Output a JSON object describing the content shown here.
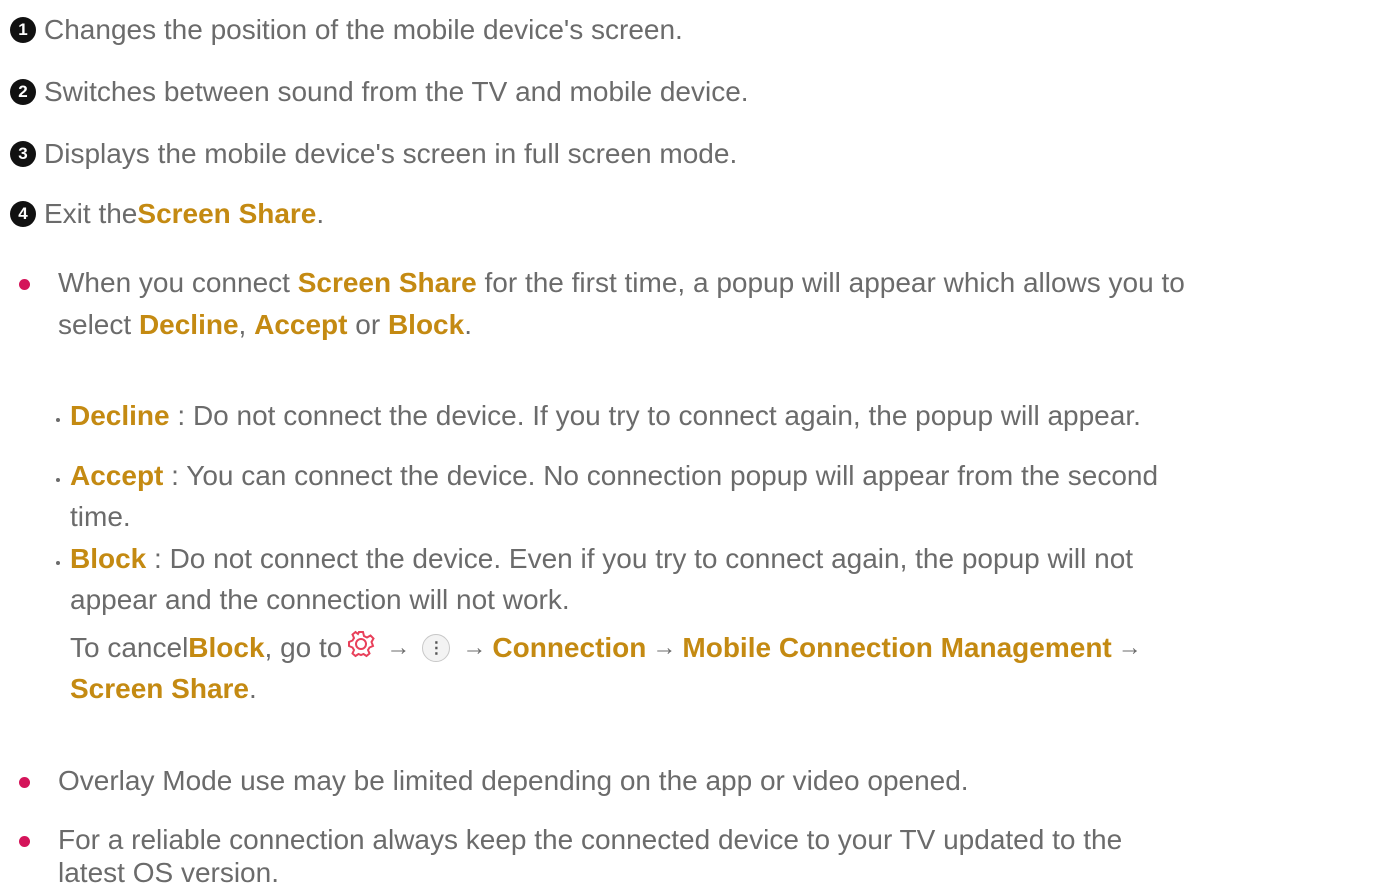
{
  "numbered": [
    {
      "number": "1",
      "text": "Changes the position of the mobile device's screen."
    },
    {
      "number": "2",
      "text": "Switches between sound from the TV and mobile device."
    },
    {
      "number": "3",
      "text": "Displays the mobile device's screen in full screen mode."
    },
    {
      "number": "4",
      "text_before": "Exit the ",
      "highlight": "Screen Share",
      "text_after": "."
    }
  ],
  "bullet1": {
    "line1_a": "When you connect ",
    "line1_hl": "Screen Share",
    "line1_b": " for the first time, a popup will appear which allows you to",
    "line2_a": "select ",
    "decline": "Decline",
    "comma": ", ",
    "accept": "Accept",
    "or": " or ",
    "block": "Block",
    "period": "."
  },
  "sub_items": {
    "decline": {
      "label": "Decline",
      "text": " : Do not connect the device. If you try to connect again, the popup will appear."
    },
    "accept": {
      "label": "Accept",
      "text": " : You can connect the device. No connection popup will appear from the second",
      "text2": "time."
    },
    "block": {
      "label": "Block",
      "text": " : Do not connect the device. Even if you try to connect again, the popup will not",
      "text2": "appear and the connection will not work.",
      "cancel_a": "To cancel ",
      "cancel_hl": "Block",
      "cancel_b": ", go to",
      "arrow": "→",
      "connection": "Connection",
      "mobile_connection": "Mobile Connection Management",
      "screen_share": "Screen Share",
      "period": "."
    }
  },
  "bullet2": "Overlay Mode use may be limited depending on the app or video opened.",
  "bullet3": {
    "line1": "For a reliable connection always keep the connected device to your TV updated to the",
    "line2": "latest OS version."
  },
  "icons": {
    "settings": "gear-icon",
    "more": "more-icon"
  },
  "colors": {
    "highlight": "#c48a12",
    "bullet": "#d4145a",
    "text": "#6b6b6b"
  }
}
